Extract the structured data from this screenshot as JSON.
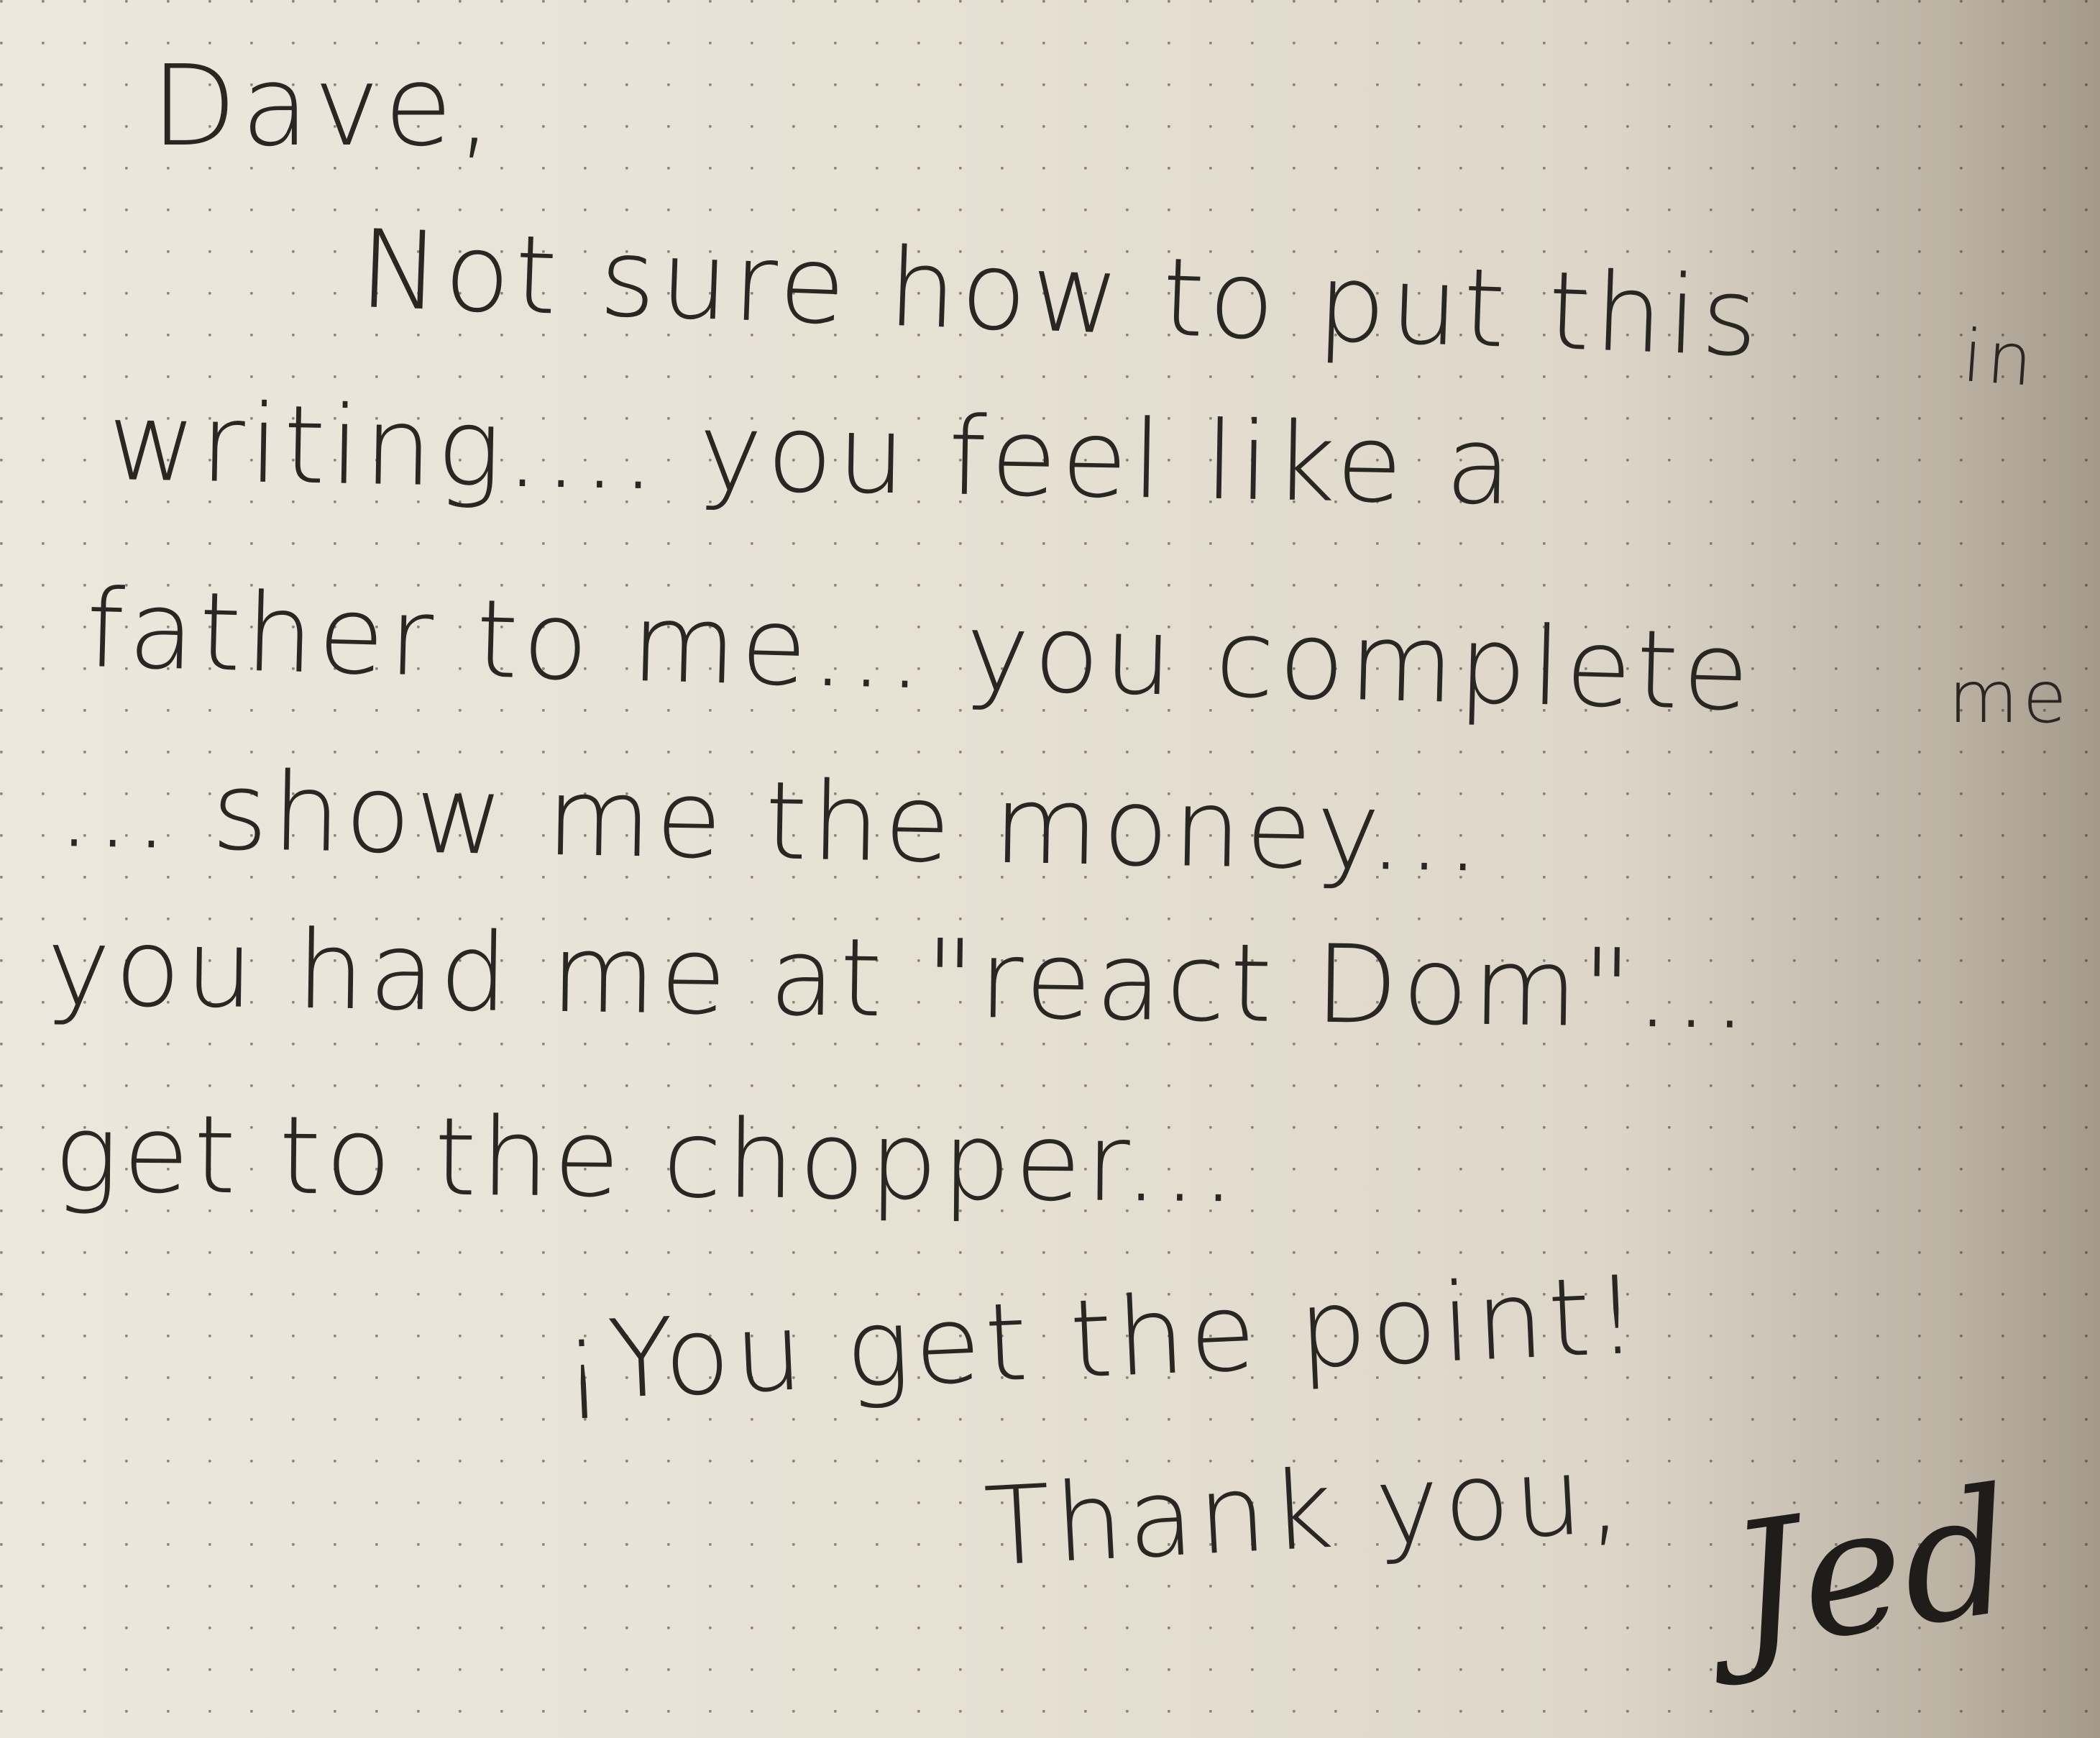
{
  "note": {
    "greeting": "Dave,",
    "lines": [
      "Not sure how to put this",
      "in",
      "writing.... you feel like a",
      "father to me... you complete",
      "me",
      "... show me the money...",
      "you had me at \"react Dom\"...",
      "get to the chopper...",
      "¡You get the point!",
      "Thank you,"
    ],
    "signature": "Jed"
  }
}
